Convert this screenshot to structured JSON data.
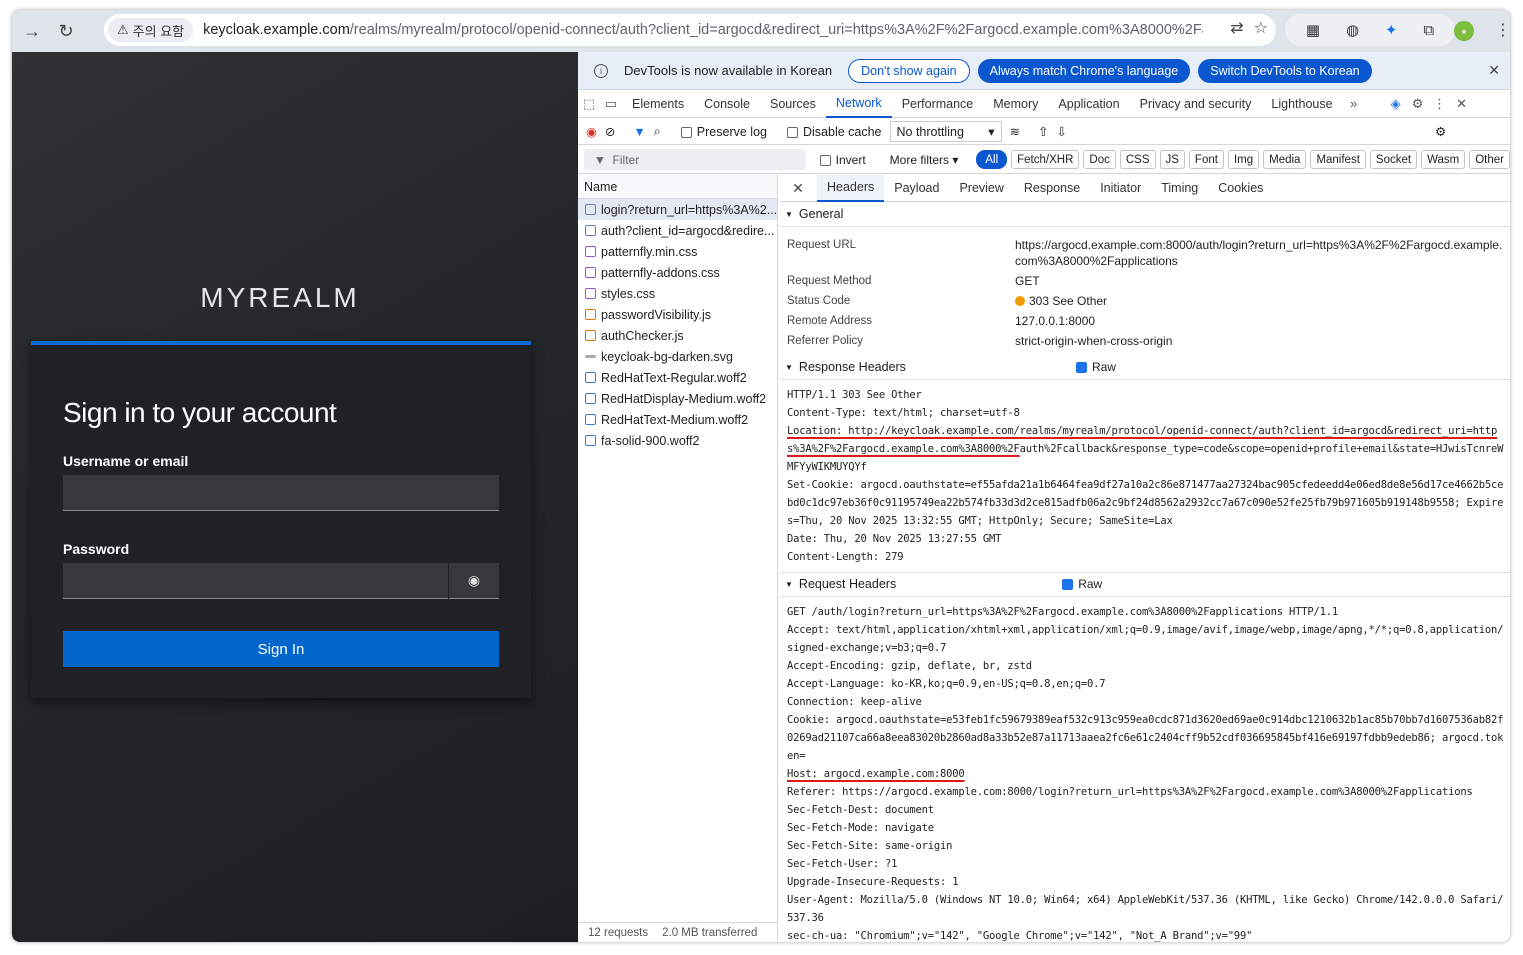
{
  "browser": {
    "security_chip": "주의 요함",
    "url_host": "keycloak.example.com",
    "url_rest": "/realms/myrealm/protocol/openid-connect/auth?client_id=argocd&redirect_uri=https%3A%2F%2Fargocd.example.com%3A8000%2Fa..."
  },
  "login": {
    "realm": "MYREALM",
    "heading": "Sign in to your account",
    "username_label": "Username or email",
    "password_label": "Password",
    "button": "Sign In"
  },
  "devtools": {
    "info_msg": "DevTools is now available in Korean",
    "dont_show": "Don't show again",
    "always_match": "Always match Chrome's language",
    "switch": "Switch DevTools to Korean",
    "tabs": [
      "Elements",
      "Console",
      "Sources",
      "Network",
      "Performance",
      "Memory",
      "Application",
      "Privacy and security",
      "Lighthouse"
    ],
    "toolbar": {
      "preserve": "Preserve log",
      "disable_cache": "Disable cache",
      "throttle": "No throttling"
    },
    "filter": {
      "placeholder": "Filter",
      "invert": "Invert",
      "more": "More filters",
      "chips": [
        "All",
        "Fetch/XHR",
        "Doc",
        "CSS",
        "JS",
        "Font",
        "Img",
        "Media",
        "Manifest",
        "Socket",
        "Wasm",
        "Other"
      ]
    },
    "name_header": "Name",
    "requests": [
      {
        "name": "login?return_url=https%3A%2...",
        "type": "doc"
      },
      {
        "name": "auth?client_id=argocd&redire...",
        "type": "doc"
      },
      {
        "name": "patternfly.min.css",
        "type": "css"
      },
      {
        "name": "patternfly-addons.css",
        "type": "css"
      },
      {
        "name": "styles.css",
        "type": "css"
      },
      {
        "name": "passwordVisibility.js",
        "type": "js"
      },
      {
        "name": "authChecker.js",
        "type": "js"
      },
      {
        "name": "keycloak-bg-darken.svg",
        "type": "svg"
      },
      {
        "name": "RedHatText-Regular.woff2",
        "type": "font"
      },
      {
        "name": "RedHatDisplay-Medium.woff2",
        "type": "font"
      },
      {
        "name": "RedHatText-Medium.woff2",
        "type": "font"
      },
      {
        "name": "fa-solid-900.woff2",
        "type": "font"
      }
    ],
    "status_bar": {
      "requests": "12 requests",
      "transferred": "2.0 MB transferred"
    },
    "detail_tabs": [
      "Headers",
      "Payload",
      "Preview",
      "Response",
      "Initiator",
      "Timing",
      "Cookies"
    ],
    "general": {
      "title": "General",
      "request_url_label": "Request URL",
      "request_url": "https://argocd.example.com:8000/auth/login?return_url=https%3A%2F%2Fargocd.example.com%3A8000%2Fapplications",
      "method_label": "Request Method",
      "method": "GET",
      "status_label": "Status Code",
      "status": "303 See Other",
      "remote_label": "Remote Address",
      "remote": "127.0.0.1:8000",
      "referrer_label": "Referrer Policy",
      "referrer": "strict-origin-when-cross-origin"
    },
    "response": {
      "title": "Response Headers",
      "raw": "Raw",
      "status_line": "HTTP/1.1 303 See Other",
      "content_type": "Content-Type: text/html; charset=utf-8",
      "location_a": "Location: http://keycloak.example.com/realms/myrealm/protocol/openid-connect/auth?client_id=argocd&redirect_uri=https%3A%2F%2Fargocd.example.com%3A8000%2F",
      "location_b": "auth%2Fcallback&response_type=code&scope=openid+profile+email&state=HJwisTcnreWMFYyWIKMUYQYf",
      "set_cookie": "Set-Cookie: argocd.oauthstate=ef55afda21a1b6464fea9df27a10a2c86e871477aa27324bac905cfedeedd4e06ed8de8e56d17ce4662b5cebd0c1dc97eb36f0c91195749ea22b574fb33d3d2ce815adfb06a2c9bf24d8562a2932cc7a67c090e52fe25fb79b971605b919148b9558; Expires=Thu, 20 Nov 2025 13:32:55 GMT; HttpOnly; Secure; SameSite=Lax",
      "date": "Date: Thu, 20 Nov 2025 13:27:55 GMT",
      "content_length": "Content-Length: 279"
    },
    "request": {
      "title": "Request Headers",
      "raw": "Raw",
      "get_line": "GET /auth/login?return_url=https%3A%2F%2Fargocd.example.com%3A8000%2Fapplications HTTP/1.1",
      "accept": "Accept: text/html,application/xhtml+xml,application/xml;q=0.9,image/avif,image/webp,image/apng,*/*;q=0.8,application/signed-exchange;v=b3;q=0.7",
      "accept_encoding": "Accept-Encoding: gzip, deflate, br, zstd",
      "accept_language": "Accept-Language: ko-KR,ko;q=0.9,en-US;q=0.8,en;q=0.7",
      "connection": "Connection: keep-alive",
      "cookie": "Cookie: argocd.oauthstate=e53feb1fc59679389eaf532c913c959ea0cdc871d3620ed69ae0c914dbc1210632b1ac85b70bb7d1607536ab82f0269ad21107ca66a8eea83020b2860ad8a33b52e87a11713aaea2fc6e61c2404cff9b52cdf036695845bf416e69197fdbb9edeb86; argocd.token=",
      "host": "Host: argocd.example.com:8000",
      "referer": "Referer: https://argocd.example.com:8000/login?return_url=https%3A%2F%2Fargocd.example.com%3A8000%2Fapplications",
      "fetch_dest": "Sec-Fetch-Dest: document",
      "fetch_mode": "Sec-Fetch-Mode: navigate",
      "fetch_site": "Sec-Fetch-Site: same-origin",
      "fetch_user": "Sec-Fetch-User: ?1",
      "upgrade": "Upgrade-Insecure-Requests: 1",
      "user_agent": "User-Agent: Mozilla/5.0 (Windows NT 10.0; Win64; x64) AppleWebKit/537.36 (KHTML, like Gecko) Chrome/142.0.0.0 Safari/537.36",
      "sec_ch_ua": "sec-ch-ua: \"Chromium\";v=\"142\", \"Google Chrome\";v=\"142\", \"Not_A Brand\";v=\"99\""
    }
  },
  "colors": {
    "accent": "#0b57d0",
    "login_bar": "#0e6cd6",
    "highlight": "#e0191b",
    "status_dot": "#f29900"
  }
}
